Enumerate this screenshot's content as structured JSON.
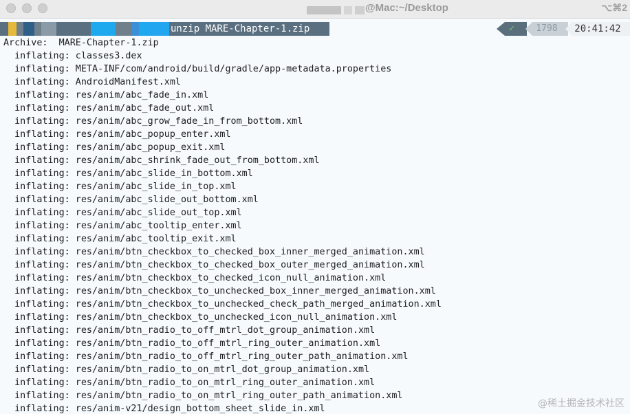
{
  "window": {
    "title": "@Mac:~/Desktop",
    "shortcut": "⌥⌘2"
  },
  "prompt": {
    "command": "unzip MARE-Chapter-1.zip",
    "status_symbol": "✓",
    "history_number": "1798",
    "time": "20:41:42"
  },
  "output": [
    "Archive:  MARE-Chapter-1.zip",
    "  inflating: classes3.dex",
    "  inflating: META-INF/com/android/build/gradle/app-metadata.properties",
    "  inflating: AndroidManifest.xml",
    "  inflating: res/anim/abc_fade_in.xml",
    "  inflating: res/anim/abc_fade_out.xml",
    "  inflating: res/anim/abc_grow_fade_in_from_bottom.xml",
    "  inflating: res/anim/abc_popup_enter.xml",
    "  inflating: res/anim/abc_popup_exit.xml",
    "  inflating: res/anim/abc_shrink_fade_out_from_bottom.xml",
    "  inflating: res/anim/abc_slide_in_bottom.xml",
    "  inflating: res/anim/abc_slide_in_top.xml",
    "  inflating: res/anim/abc_slide_out_bottom.xml",
    "  inflating: res/anim/abc_slide_out_top.xml",
    "  inflating: res/anim/abc_tooltip_enter.xml",
    "  inflating: res/anim/abc_tooltip_exit.xml",
    "  inflating: res/anim/btn_checkbox_to_checked_box_inner_merged_animation.xml",
    "  inflating: res/anim/btn_checkbox_to_checked_box_outer_merged_animation.xml",
    "  inflating: res/anim/btn_checkbox_to_checked_icon_null_animation.xml",
    "  inflating: res/anim/btn_checkbox_to_unchecked_box_inner_merged_animation.xml",
    "  inflating: res/anim/btn_checkbox_to_unchecked_check_path_merged_animation.xml",
    "  inflating: res/anim/btn_checkbox_to_unchecked_icon_null_animation.xml",
    "  inflating: res/anim/btn_radio_to_off_mtrl_dot_group_animation.xml",
    "  inflating: res/anim/btn_radio_to_off_mtrl_ring_outer_animation.xml",
    "  inflating: res/anim/btn_radio_to_off_mtrl_ring_outer_path_animation.xml",
    "  inflating: res/anim/btn_radio_to_on_mtrl_dot_group_animation.xml",
    "  inflating: res/anim/btn_radio_to_on_mtrl_ring_outer_animation.xml",
    "  inflating: res/anim/btn_radio_to_on_mtrl_ring_outer_path_animation.xml",
    "  inflating: res/anim-v21/design_bottom_sheet_slide_in.xml"
  ],
  "watermark": "@稀土掘金技术社区",
  "colors": {
    "background": "#f6fafd",
    "command_highlight": "#5a6f80",
    "status_ok": "#6fd36f"
  },
  "icons": {
    "status": "checkmark-icon"
  }
}
